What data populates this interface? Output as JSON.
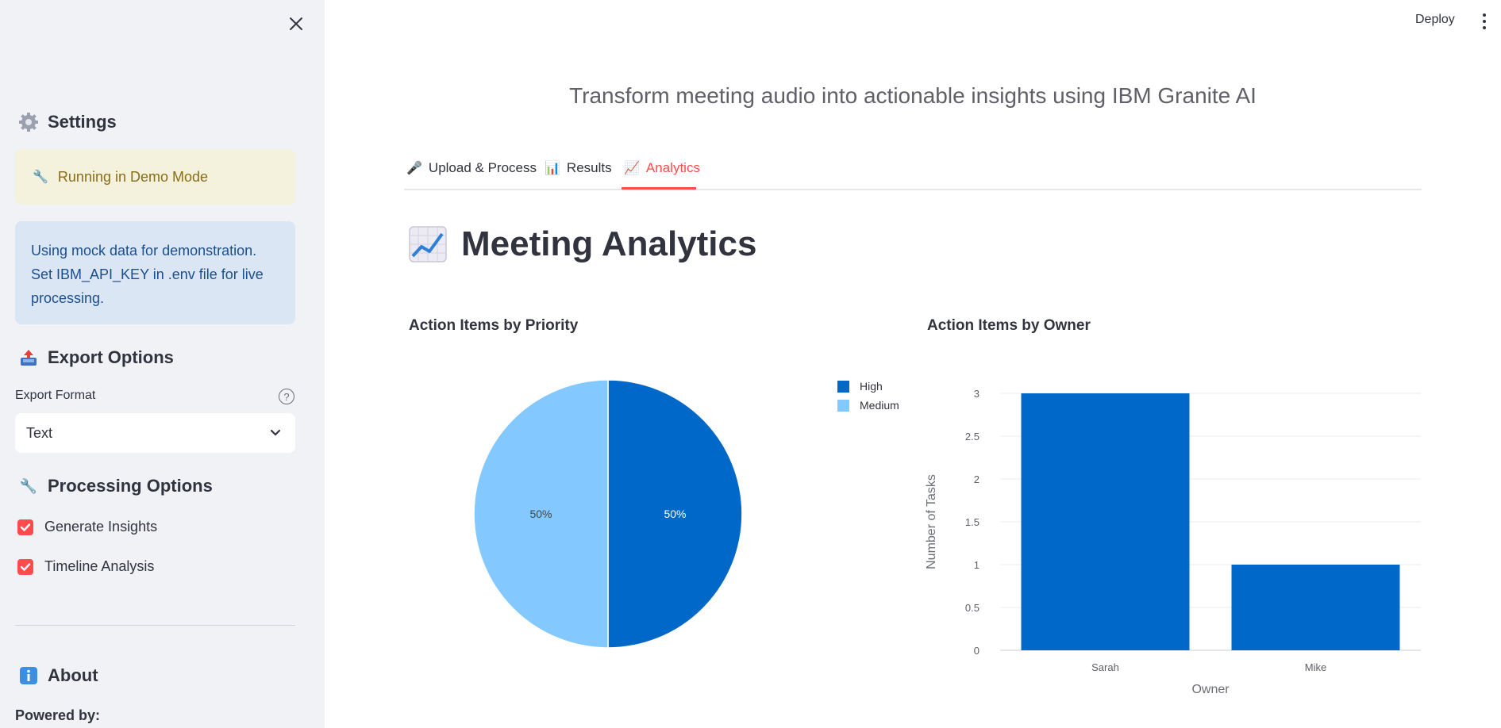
{
  "sidebar": {
    "settings_title": "Settings",
    "settings_icon": "gear-icon",
    "demo_warning": "Running in Demo Mode",
    "demo_info": "Using mock data for demonstration. Set IBM_API_KEY in .env file for live processing.",
    "export_title": "Export Options",
    "export_format_label": "Export Format",
    "export_format_value": "Text",
    "processing_title": "Processing Options",
    "options": [
      {
        "label": "Generate Insights",
        "checked": true
      },
      {
        "label": "Timeline Analysis",
        "checked": true
      }
    ],
    "about_title": "About",
    "powered_by": "Powered by:"
  },
  "header": {
    "deploy_label": "Deploy"
  },
  "main": {
    "subtitle": "Transform meeting audio into actionable insights using IBM Granite AI",
    "tabs": [
      {
        "label": "Upload & Process",
        "icon": "microphone-icon"
      },
      {
        "label": "Results",
        "icon": "bar-chart-icon"
      },
      {
        "label": "Analytics",
        "icon": "trend-chart-icon",
        "active": true
      }
    ],
    "page_title": "Meeting Analytics"
  },
  "colors": {
    "accent": "#ff4b4b",
    "high": "#0068c9",
    "medium": "#83c9ff",
    "bar": "#0068c9"
  },
  "chart_data": [
    {
      "type": "pie",
      "title": "Action Items by Priority",
      "labels": [
        "High",
        "Medium"
      ],
      "values": [
        50,
        50
      ],
      "value_labels": [
        "50%",
        "50%"
      ],
      "legend": "right"
    },
    {
      "type": "bar",
      "title": "Action Items by Owner",
      "categories": [
        "Sarah",
        "Mike"
      ],
      "values": [
        3,
        1
      ],
      "xlabel": "Owner",
      "ylabel": "Number of Tasks",
      "ylim": [
        0,
        3
      ],
      "yticks": [
        "0",
        "0.5",
        "1",
        "1.5",
        "2",
        "2.5",
        "3"
      ],
      "grid": true
    }
  ]
}
